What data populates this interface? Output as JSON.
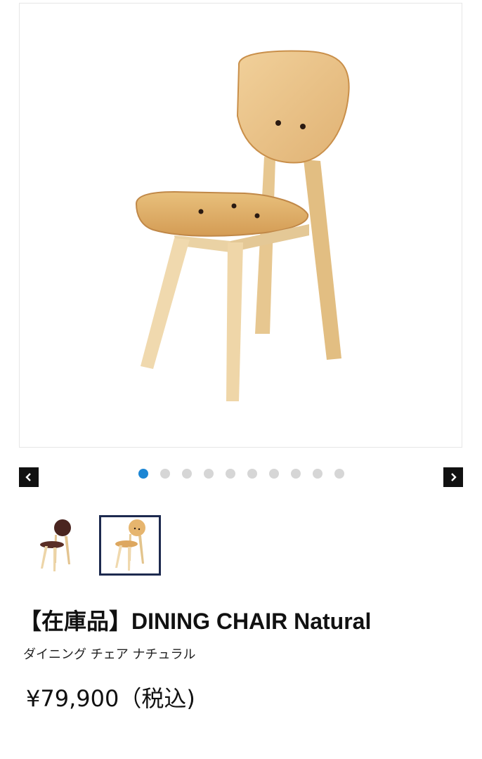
{
  "product": {
    "title": "【在庫品】DINING CHAIR Natural",
    "subtitle": "ダイニング チェア ナチュラル",
    "price": "¥79,900（税込)",
    "main_image": "natural-wood-chair",
    "thumbnails": [
      {
        "variant": "dark-brown-chair",
        "selected": false
      },
      {
        "variant": "natural-wood-chair",
        "selected": true
      }
    ]
  },
  "carousel": {
    "total_slides": 10,
    "active_slide": 1,
    "prev_icon": "chevron-left-icon",
    "next_icon": "chevron-right-icon"
  },
  "colors": {
    "wood_light": "#E9C68E",
    "wood_mid": "#D9AB66",
    "walnut": "#4A2520",
    "dot_active": "#1C86D4",
    "dot_inactive": "#D6D6D6",
    "thumb_border": "#1D2A4F"
  }
}
